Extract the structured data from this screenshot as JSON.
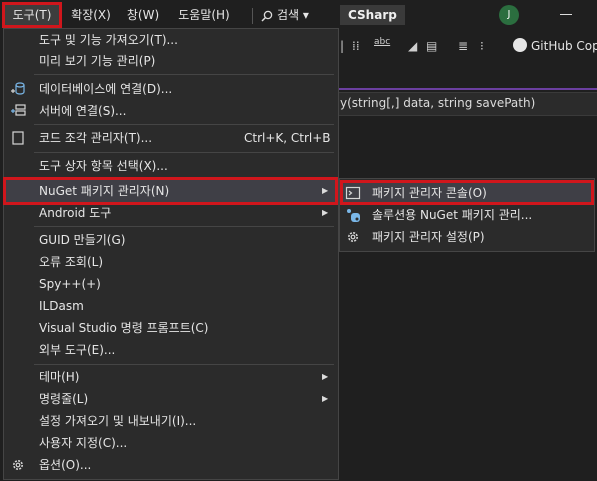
{
  "menubar": {
    "tools": "도구(T)",
    "extensions": "확장(X)",
    "window": "창(W)",
    "help": "도움말(H)",
    "search": "검색 ▾",
    "project": "CSharp",
    "avatar_initial": "J"
  },
  "toolbar": {
    "abc": "abc",
    "copilot": "GitHub Cop"
  },
  "editor": {
    "signature": "y(string[,] data, string savePath)"
  },
  "menu": {
    "items": [
      {
        "label": "도구 및 기능 가져오기(T)..."
      },
      {
        "label": "미리 보기 기능 관리(P)"
      },
      {
        "label": "데이터베이스에 연결(D)..."
      },
      {
        "label": "서버에 연결(S)..."
      },
      {
        "label": "코드 조각 관리자(T)...",
        "shortcut": "Ctrl+K, Ctrl+B"
      },
      {
        "label": "도구 상자 항목 선택(X)..."
      },
      {
        "label": "NuGet 패키지 관리자(N)"
      },
      {
        "label": "Android 도구"
      },
      {
        "label": "GUID 만들기(G)"
      },
      {
        "label": "오류 조회(L)"
      },
      {
        "label": "Spy++(+)"
      },
      {
        "label": "ILDasm"
      },
      {
        "label": "Visual Studio 명령 프롬프트(C)"
      },
      {
        "label": "외부 도구(E)..."
      },
      {
        "label": "테마(H)"
      },
      {
        "label": "명령줄(L)"
      },
      {
        "label": "설정 가져오기 및 내보내기(I)..."
      },
      {
        "label": "사용자 지정(C)..."
      },
      {
        "label": "옵션(O)..."
      }
    ]
  },
  "submenu": {
    "items": [
      {
        "label": "패키지 관리자 콘솔(O)"
      },
      {
        "label": "솔루션용 NuGet 패키지 관리..."
      },
      {
        "label": "패키지 관리자 설정(P)"
      }
    ]
  },
  "colors": {
    "highlight_border": "#d0161c",
    "menu_bg": "#2b2b2b",
    "hover_bg": "#3f3f46"
  }
}
